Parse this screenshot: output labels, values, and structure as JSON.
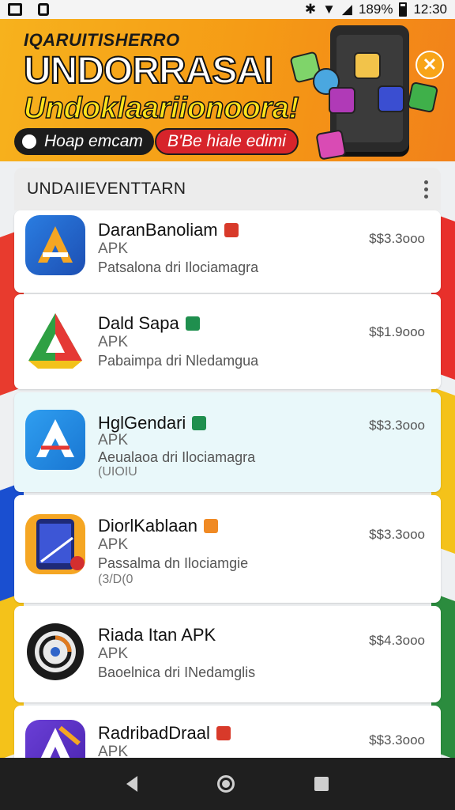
{
  "status_bar": {
    "battery": "189%",
    "time": "12:30"
  },
  "banner": {
    "supertitle": "IQARUITISHERRO",
    "headline": "UNDORRASAI",
    "subheadline": "Undoklaariionoora!",
    "primary_button": "Hoap emcam",
    "secondary_button": "B'Be hiale edimi"
  },
  "list": {
    "header_title": "UNDAIIEVENTTARN",
    "items": [
      {
        "name": "DaranBanoliam",
        "type": "APK",
        "description": "Patsalona dri Ilociamagra",
        "extra": "",
        "price": "$$3.3ooo",
        "badge_color": "#d83a2a"
      },
      {
        "name": "Dald Sapa",
        "type": "APK",
        "description": "Pabaimpa dri Nledamgua",
        "extra": "",
        "price": "$$1.9ooo",
        "badge_color": "#1f8f4e"
      },
      {
        "name": "HglGendari",
        "type": "APK",
        "description": "Aeualaoa dri Ilociamagra",
        "extra": "(UIOIU",
        "price": "$$3.3ooo",
        "badge_color": "#1f8f4e"
      },
      {
        "name": "DiorlKablaan",
        "type": "APK",
        "description": "Passalma dn Ilociamgie",
        "extra": "(3/D(0",
        "price": "$$3.3ooo",
        "badge_color": "#f08a24"
      },
      {
        "name": "Riada Itan APK",
        "type": "APK",
        "description": "Baoelnica dri INedamglis",
        "extra": "",
        "price": "$$4.3ooo",
        "badge_color": ""
      },
      {
        "name": "RadribadDraal",
        "type": "APK",
        "description": "",
        "extra": "",
        "price": "$$3.3ooo",
        "badge_color": "#d83a2a"
      }
    ]
  },
  "colors": {
    "banner_orange": "#f59a15",
    "accent_red": "#d7242b",
    "selected_row": "#e9f8fa"
  }
}
